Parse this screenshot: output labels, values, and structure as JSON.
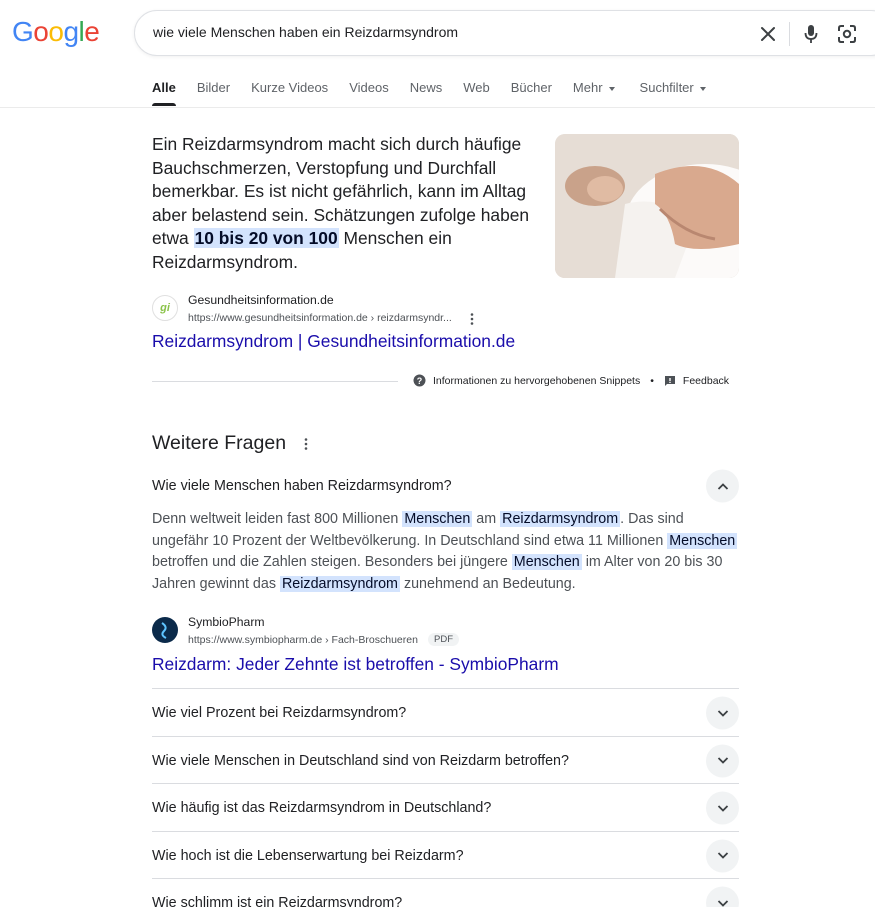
{
  "logo": {
    "letters": [
      {
        "ch": "G",
        "color": "#4285F4"
      },
      {
        "ch": "o",
        "color": "#EA4335"
      },
      {
        "ch": "o",
        "color": "#FBBC05"
      },
      {
        "ch": "g",
        "color": "#4285F4"
      },
      {
        "ch": "l",
        "color": "#34A853"
      },
      {
        "ch": "e",
        "color": "#EA4335"
      }
    ]
  },
  "search": {
    "query": "wie viele Menschen haben ein Reizdarmsyndrom",
    "icons": [
      "close-icon",
      "microphone-icon",
      "lens-icon"
    ]
  },
  "tabs": [
    {
      "label": "Alle",
      "active": true
    },
    {
      "label": "Bilder"
    },
    {
      "label": "Kurze Videos"
    },
    {
      "label": "Videos"
    },
    {
      "label": "News"
    },
    {
      "label": "Web"
    },
    {
      "label": "Bücher"
    },
    {
      "label": "Mehr",
      "dropdown": true
    },
    {
      "label": "Suchfilter",
      "dropdown": true
    }
  ],
  "snippet": {
    "text_before": "Ein Reizdarmsyndrom macht sich durch häufige Bauchschmerzen, Verstopfung und Durchfall bemerkbar. Es ist nicht gefährlich, kann im Alltag aber belastend sein. Schätzungen zufolge haben etwa ",
    "highlight": "10 bis 20 von 100",
    "text_after": " Menschen ein Reizdarmsyndrom.",
    "source_name": "Gesundheitsinformation.de",
    "source_url": "https://www.gesundheitsinformation.de › reizdarmsyndr...",
    "favicon_text": "gi",
    "title": "Reizdarmsyndrom | Gesundheitsinformation.de",
    "info_label": "Informationen zu hervorgehobenen Snippets",
    "separator": "•",
    "feedback_label": "Feedback"
  },
  "paa": {
    "title": "Weitere Fragen",
    "expanded": {
      "question": "Wie viele Menschen haben Reizdarmsyndrom?",
      "answer_parts": [
        {
          "t": "Denn weltweit leiden fast 800 Millionen "
        },
        {
          "t": "Menschen",
          "hl": true
        },
        {
          "t": " am "
        },
        {
          "t": "Reizdarmsyndrom",
          "hl": true
        },
        {
          "t": ". Das sind ungefähr 10 Prozent der Weltbevölkerung. In Deutschland sind etwa 11 Millionen "
        },
        {
          "t": "Menschen",
          "hl": true
        },
        {
          "t": " betroffen und die Zahlen steigen. Besonders bei jüngere "
        },
        {
          "t": "Menschen",
          "hl": true
        },
        {
          "t": " im Alter von 20 bis 30 Jahren gewinnt das "
        },
        {
          "t": "Reizdarmsyndrom",
          "hl": true
        },
        {
          "t": " zunehmend an Bedeutung."
        }
      ],
      "source_name": "SymbioPharm",
      "source_url": "https://www.symbiopharm.de › Fach-Broschueren",
      "badge": "PDF",
      "title": "Reizdarm: Jeder Zehnte ist betroffen - SymbioPharm"
    },
    "questions": [
      "Wie viel Prozent bei Reizdarmsyndrom?",
      "Wie viele Menschen in Deutschland sind von Reizdarm betroffen?",
      "Wie häufig ist das Reizdarmsyndrom in Deutschland?",
      "Wie hoch ist die Lebenserwartung bei Reizdarm?",
      "Wie schlimm ist ein Reizdarmsyndrom?"
    ]
  },
  "colors": {
    "link": "#1a0dab",
    "highlight": "#d3e3fd",
    "text": "#202124",
    "muted": "#4d5156"
  }
}
